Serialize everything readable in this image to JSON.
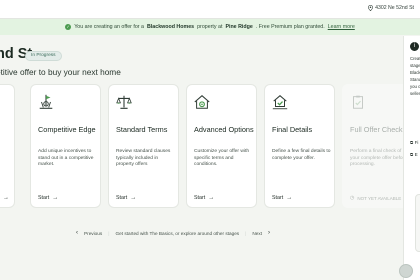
{
  "header": {
    "address": "4302 Ne 52nd St"
  },
  "banner": {
    "prefix": "You are creating an offer for a",
    "company": "Blackwood Homes",
    "middle": "property at",
    "community": "Pine Ridge",
    "suffix": ". Free Premium plan granted.",
    "link": "Learn more"
  },
  "page": {
    "title_fragment": "nd St",
    "status_badge": "In Progress",
    "subtitle_fragment": "etitive offer to buy your next home"
  },
  "cards": [
    {
      "icon": "flag-ribbon-icon",
      "title": "Competitive Edge",
      "description": "Add unique incentives to stand out in a competitive market.",
      "action": "Start"
    },
    {
      "icon": "scales-icon",
      "title": "Standard Terms",
      "description": "Review standard clauses typically included in property offers",
      "action": "Start"
    },
    {
      "icon": "house-gear-icon",
      "title": "Advanced Options",
      "description": "Customize your offer with specific terms and conditions.",
      "action": "Start"
    },
    {
      "icon": "house-check-icon",
      "title": "Final Details",
      "description": "Define a few final details to complete your offer.",
      "action": "Start"
    },
    {
      "icon": "clipboard-check-icon",
      "title": "Full Offer Check",
      "description": "Perform a final check of your complete offer before processing.",
      "action": "NOT YET AVAILABLE",
      "disabled": true
    }
  ],
  "pagination": {
    "previous": "Previous",
    "middle": "Get started with The Basics, or explore around other stages",
    "next": "Next"
  },
  "side_panel": {
    "text_fragment": "Creat\nstage\nBlack\nStand\nyou c\nseller",
    "link_1": "Fi",
    "link_2": "E",
    "card_line_1": "V",
    "card_line_2": "S"
  },
  "colors": {
    "accent_green": "#4a9a4e",
    "banner_bg": "#e3f3e1",
    "page_bg": "#f3f5f1"
  }
}
